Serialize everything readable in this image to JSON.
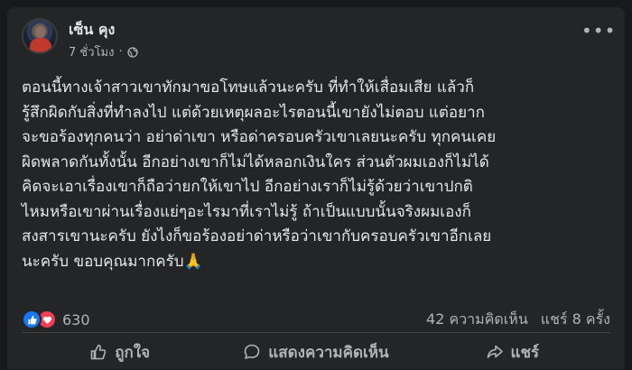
{
  "post": {
    "author": "เซ็น คุง",
    "time": "7 ชั่วโมง",
    "separator": "·",
    "text": "ตอนนี้ทางเจ้าสาวเขาทักมาขอโทษแล้วนะครับ ที่ทำให้เสื่อมเสีย แล้วก็\nรู้สึกผิดกับสิ่งที่ทำลงไป แต่ด้วยเหตุผลอะไรตอนนี้เขายังไม่ตอบ แต่อยาก\nจะขอร้องทุกคนว่า อย่าด่าเขา หรือด่าครอบครัวเขาเลยนะครับ ทุกคนเคย\nผิดพลาดกันทั้งนั้น อีกอย่างเขาก็ไม่ได้หลอกเงินใคร ส่วนตัวผมเองก็ไม่ได้\nคิดจะเอาเรื่องเขาก็ถือว่ายกให้เขาไป อีกอย่างเราก็ไม่รู้ด้วยว่าเขาปกติ\nไหมหรือเขาผ่านเรื่องแย่ๆอะไรมาที่เราไม่รู้ ถ้าเป็นแบบนั้นจริงผมเองก็\nสงสารเขานะครับ ยังไงก็ขอร้องอย่าด่าหรือว่าเขากับครอบครัวเขาอีกเลย\nนะครับ ขอบคุณมากครับ🙏"
  },
  "stats": {
    "reactions": "630",
    "comments": "42 ความคิดเห็น",
    "shares": "แชร์ 8 ครั้ง"
  },
  "actions": {
    "like": "ถูกใจ",
    "comment": "แสดงความคิดเห็น",
    "share": "แชร์"
  },
  "icons": {
    "more": "more-options-icon",
    "audience": "globe-icon",
    "like_reaction": "like-reaction-icon",
    "love_reaction": "love-reaction-icon",
    "like": "thumbs-up-icon",
    "comment": "comment-icon",
    "share": "share-icon"
  },
  "colors": {
    "background": "#18191a",
    "card": "#242526",
    "text": "#e4e6eb",
    "secondary_text": "#b0b3b8",
    "like_blue": "#1877f2",
    "love_red": "#f33e58"
  }
}
